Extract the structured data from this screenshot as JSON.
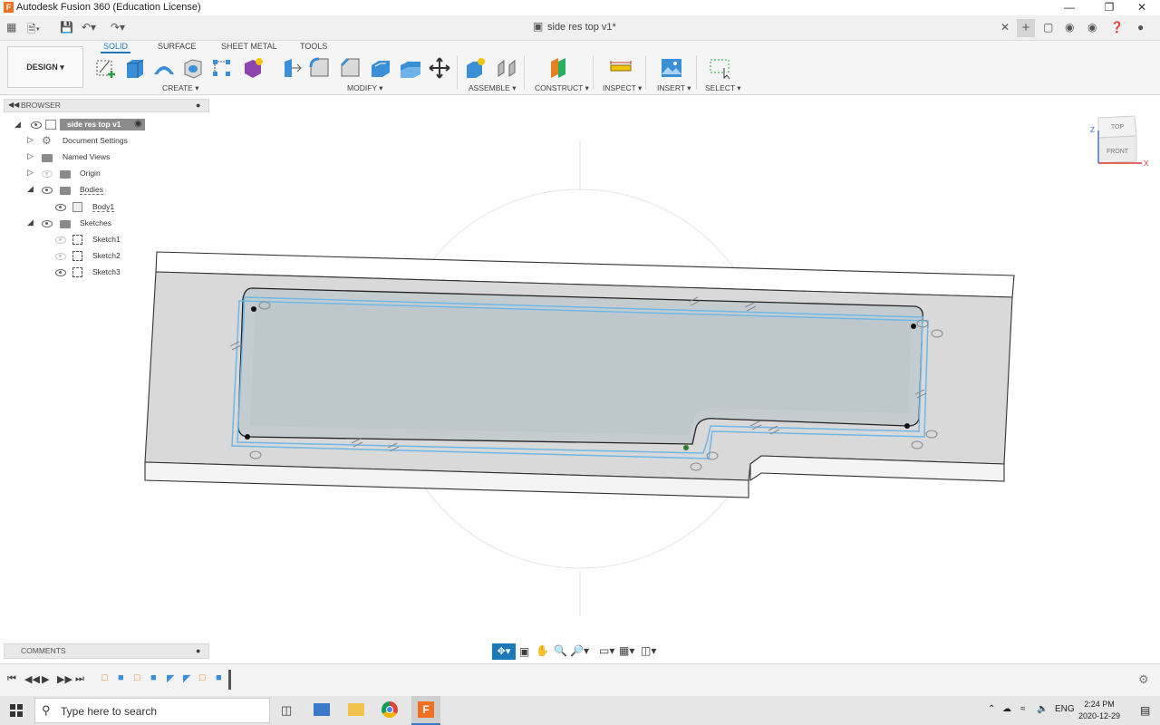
{
  "window": {
    "app_title": "Autodesk Fusion 360 (Education License)",
    "document_tab": "side res top v1*"
  },
  "ribbon": {
    "workspace": "DESIGN",
    "tabs": [
      "SOLID",
      "SURFACE",
      "SHEET METAL",
      "TOOLS"
    ],
    "active_tab": "SOLID",
    "groups": [
      "CREATE",
      "MODIFY",
      "ASSEMBLE",
      "CONSTRUCT",
      "INSPECT",
      "INSERT",
      "SELECT"
    ]
  },
  "browser": {
    "header": "BROWSER",
    "root": "side res top v1",
    "items": [
      "Document Settings",
      "Named Views",
      "Origin",
      "Bodies",
      "Body1",
      "Sketches",
      "Sketch1",
      "Sketch2",
      "Sketch3"
    ]
  },
  "viewcube": {
    "top": "TOP",
    "front": "FRONT",
    "axis_x": "X",
    "axis_z": "Z"
  },
  "comments": {
    "label": "COMMENTS"
  },
  "taskbar": {
    "search_placeholder": "Type here to search",
    "language": "ENG",
    "time": "2:24 PM",
    "date": "2020-12-29"
  }
}
